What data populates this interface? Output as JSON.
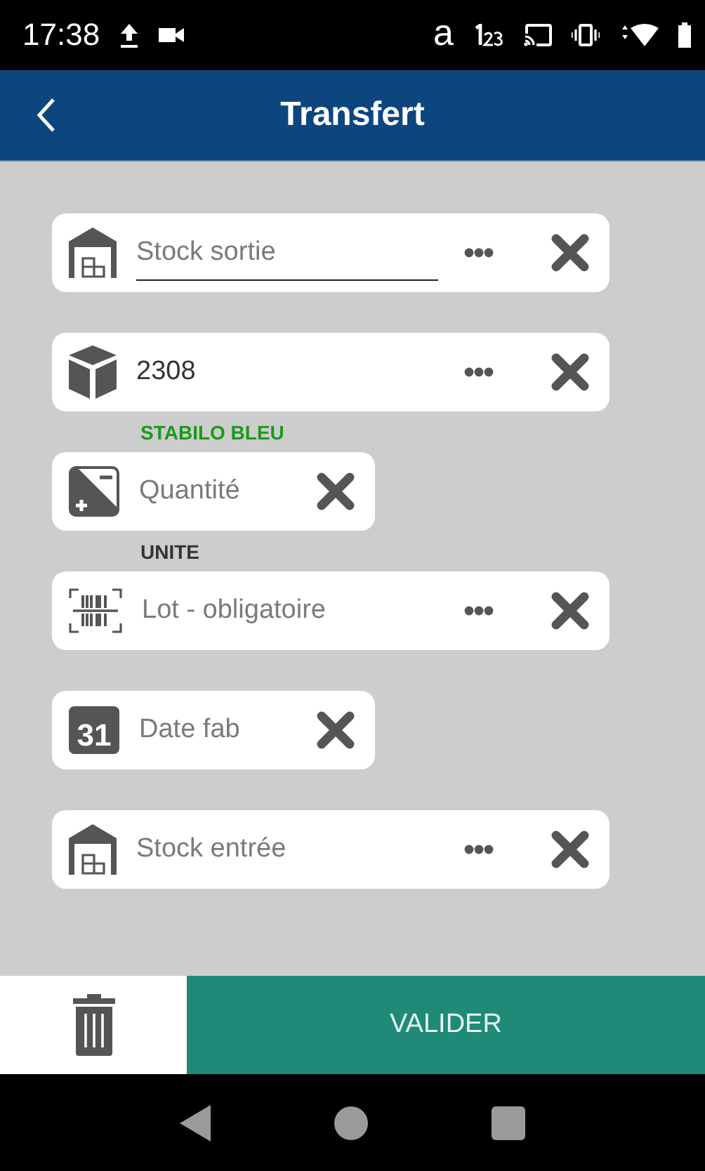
{
  "status_bar": {
    "time": "17:38",
    "letter": "a"
  },
  "app_bar": {
    "title": "Transfert"
  },
  "form": [
    {
      "kind": "field",
      "placeholder": "Stock sortie",
      "focused": true,
      "menu": true,
      "wide": true
    },
    {
      "kind": "field",
      "value": "2308",
      "focused": false,
      "menu": true,
      "wide": true
    },
    {
      "kind": "caption",
      "text": "STABILO BLEU",
      "color": "#1a9a1a"
    },
    {
      "kind": "field",
      "placeholder": "Quantité",
      "focused": false,
      "menu": false,
      "wide": false
    },
    {
      "kind": "caption",
      "text": "UNITE",
      "color": "#333333"
    },
    {
      "kind": "field",
      "placeholder": "Lot - obligatoire",
      "focused": false,
      "menu": true,
      "wide": true
    },
    {
      "kind": "field",
      "calendar_day": "31",
      "placeholder": "Date fab",
      "focused": false,
      "menu": false,
      "wide": false
    },
    {
      "kind": "field",
      "placeholder": "Stock entrée",
      "focused": false,
      "menu": true,
      "wide": true
    }
  ],
  "footer": {
    "submit_label": "VALIDER"
  }
}
